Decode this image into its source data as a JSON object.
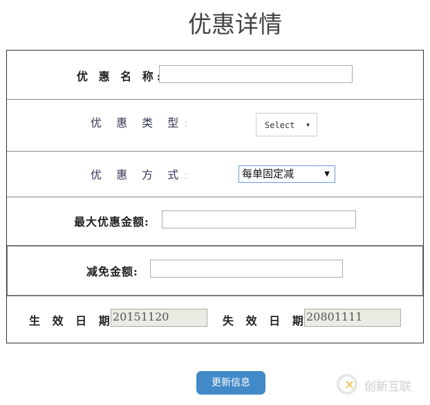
{
  "title": "优惠详情",
  "fields": {
    "name_label": "优 惠 名 称:",
    "type_label": "优 惠 类 型:",
    "type_select": "Select",
    "method_label": "优 惠 方 式:",
    "method_select": "每单固定减",
    "max_label": "最大优惠金额:",
    "reduce_label": "减免金额:",
    "start_label": "生 效 日 期:",
    "start_value": "20151120",
    "end_label": "失 效 日 期:",
    "end_value": "20801111"
  },
  "button": "更新信息",
  "watermark": "创新互联"
}
